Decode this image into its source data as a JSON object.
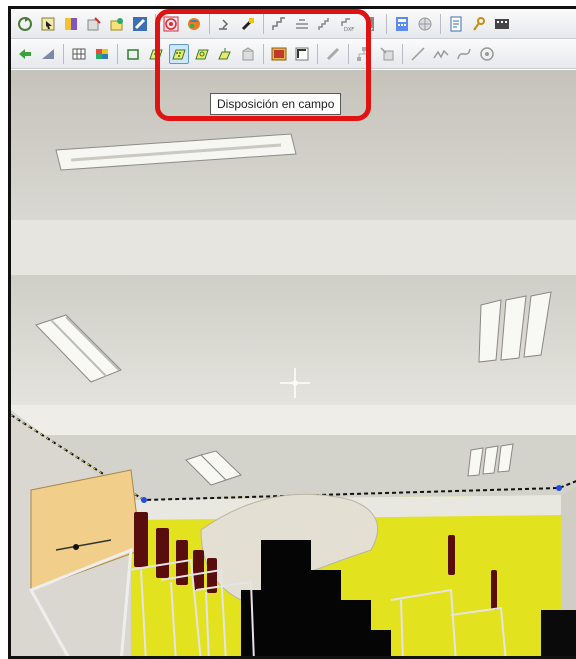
{
  "toolbar": {
    "row1": [
      {
        "icon": "rotate-view-icon"
      },
      {
        "icon": "cursor-select-icon"
      },
      {
        "icon": "color-palette-icon"
      },
      {
        "icon": "edit-object-icon"
      },
      {
        "icon": "paint-object-icon"
      },
      {
        "icon": "luminaire-blue-icon"
      },
      {
        "icon": "target-rings-icon"
      },
      {
        "icon": "colored-sphere-icon"
      },
      {
        "icon": "arrow-pointer-icon"
      },
      {
        "icon": "brush-icon"
      },
      {
        "icon": "stair-icon"
      },
      {
        "icon": "stair-outline-icon"
      },
      {
        "icon": "stair-alt-icon"
      },
      {
        "icon": "dxf-import-icon"
      },
      {
        "icon": "dropdown-arrow-icon"
      },
      {
        "icon": "calculator-icon"
      },
      {
        "icon": "globe-icon"
      },
      {
        "icon": "document-icon"
      },
      {
        "icon": "key-icon"
      },
      {
        "icon": "film-icon"
      }
    ],
    "row2": [
      {
        "icon": "green-arrows-icon"
      },
      {
        "icon": "angle-measure-icon"
      },
      {
        "icon": "grid-table-icon"
      },
      {
        "icon": "color-grid-icon"
      },
      {
        "icon": "polygon-icon"
      },
      {
        "icon": "field-layout-icon"
      },
      {
        "icon": "field-layout-active-icon",
        "active": true
      },
      {
        "icon": "field-layout-variant-icon"
      },
      {
        "icon": "field-layout-small-icon"
      },
      {
        "icon": "building-icon"
      },
      {
        "icon": "image-frame-icon"
      },
      {
        "icon": "corner-icon"
      },
      {
        "icon": "luminaire-grey-icon"
      },
      {
        "icon": "hierarchy-icon"
      },
      {
        "icon": "cursor-box-icon"
      },
      {
        "icon": "line-icon"
      },
      {
        "icon": "wave-line-icon"
      },
      {
        "icon": "curve-icon"
      },
      {
        "icon": "circle-target-icon"
      }
    ]
  },
  "tooltip": {
    "text": "Disposición en campo"
  },
  "colors": {
    "highlight_border": "#e01313",
    "active_button_bg": "#cfe6fb",
    "active_button_border": "#5b9bd5",
    "wall_yellow": "#e3e21f",
    "ceiling": "#d9d8d2"
  }
}
